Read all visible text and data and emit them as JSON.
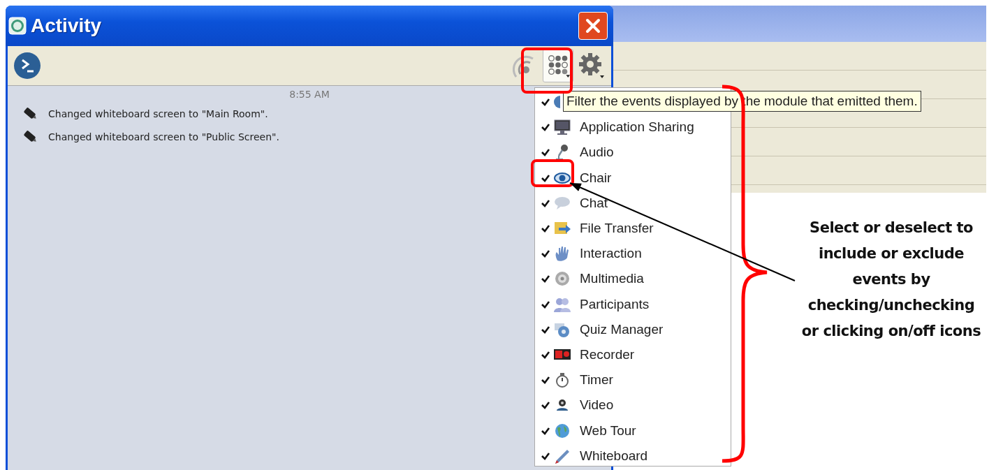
{
  "window": {
    "title": "Activity"
  },
  "toolbar": {
    "buttons": [
      {
        "kind": "broadcast",
        "pressed": false
      },
      {
        "kind": "filter",
        "pressed": true
      },
      {
        "kind": "settings",
        "pressed": false
      }
    ]
  },
  "log": {
    "time": "8:55 AM",
    "entries": [
      {
        "text": "Changed whiteboard screen to \"Main Room\"."
      },
      {
        "text": "Changed whiteboard screen to \"Public Screen\"."
      }
    ]
  },
  "tooltip": "Filter the events displayed by the module that emitted them.",
  "filter_menu": {
    "items": [
      {
        "checked": true
      },
      {
        "label": "Application Sharing",
        "checked": true
      },
      {
        "label": "Audio",
        "checked": true
      },
      {
        "label": "Chair",
        "checked": true
      },
      {
        "label": "Chat",
        "checked": true
      },
      {
        "label": "File Transfer",
        "checked": true
      },
      {
        "label": "Interaction",
        "checked": true
      },
      {
        "label": "Multimedia",
        "checked": true
      },
      {
        "label": "Participants",
        "checked": true
      },
      {
        "label": "Quiz Manager",
        "checked": true
      },
      {
        "label": "Recorder",
        "checked": true
      },
      {
        "label": "Timer",
        "checked": true
      },
      {
        "label": "Video",
        "checked": true
      },
      {
        "label": "Web Tour",
        "checked": true
      },
      {
        "label": "Whiteboard",
        "checked": true
      }
    ]
  },
  "annotation": {
    "lines": [
      "Select or deselect to",
      "include or exclude",
      "events by",
      "checking/unchecking",
      "or clicking on/off icons"
    ]
  }
}
